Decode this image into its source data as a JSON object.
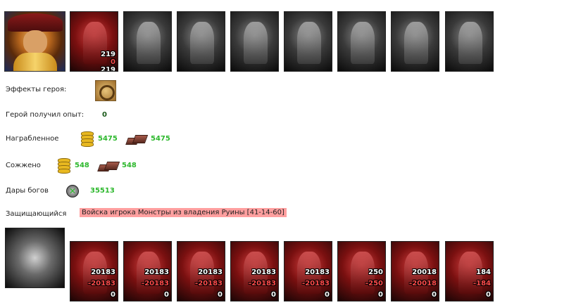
{
  "hero": {
    "portrait": "hero-portrait",
    "army": [
      {
        "kind": "color",
        "count": "219",
        "loss": "0",
        "remaining": "219"
      },
      {
        "kind": "gray"
      },
      {
        "kind": "gray"
      },
      {
        "kind": "gray"
      },
      {
        "kind": "gray"
      },
      {
        "kind": "gray"
      },
      {
        "kind": "gray"
      },
      {
        "kind": "gray"
      },
      {
        "kind": "gray"
      }
    ]
  },
  "effects": {
    "label": "Эффекты героя:",
    "icon": "artifact-ring-icon"
  },
  "experience": {
    "label": "Герой получил опыт:",
    "value": "0"
  },
  "plundered": {
    "label": "Награбленное",
    "gold": "5475",
    "ore": "5475"
  },
  "burned": {
    "label": "Сожжено",
    "gold": "548",
    "ore": "548"
  },
  "gifts": {
    "label": "Дары богов",
    "value": "35513",
    "icon": "gods-gift-icon"
  },
  "defender": {
    "label": "Защищающийся",
    "name": "Войска игрока Монстры из владения Руины [41-14-60]",
    "portrait": "defender-emblem",
    "army": [
      {
        "count": "20183",
        "loss": "-20183",
        "remaining": "0"
      },
      {
        "count": "20183",
        "loss": "-20183",
        "remaining": "0"
      },
      {
        "count": "20183",
        "loss": "-20183",
        "remaining": "0"
      },
      {
        "count": "20183",
        "loss": "-20183",
        "remaining": "0"
      },
      {
        "count": "20183",
        "loss": "-20183",
        "remaining": "0"
      },
      {
        "count": "250",
        "loss": "-250",
        "remaining": "0"
      },
      {
        "count": "20018",
        "loss": "-20018",
        "remaining": "0"
      },
      {
        "count": "184",
        "loss": "-184",
        "remaining": "0"
      }
    ]
  },
  "colors": {
    "value_green": "#2db82d",
    "loss_red": "#ff4a4a",
    "badge_pink": "#ff9f9f"
  }
}
